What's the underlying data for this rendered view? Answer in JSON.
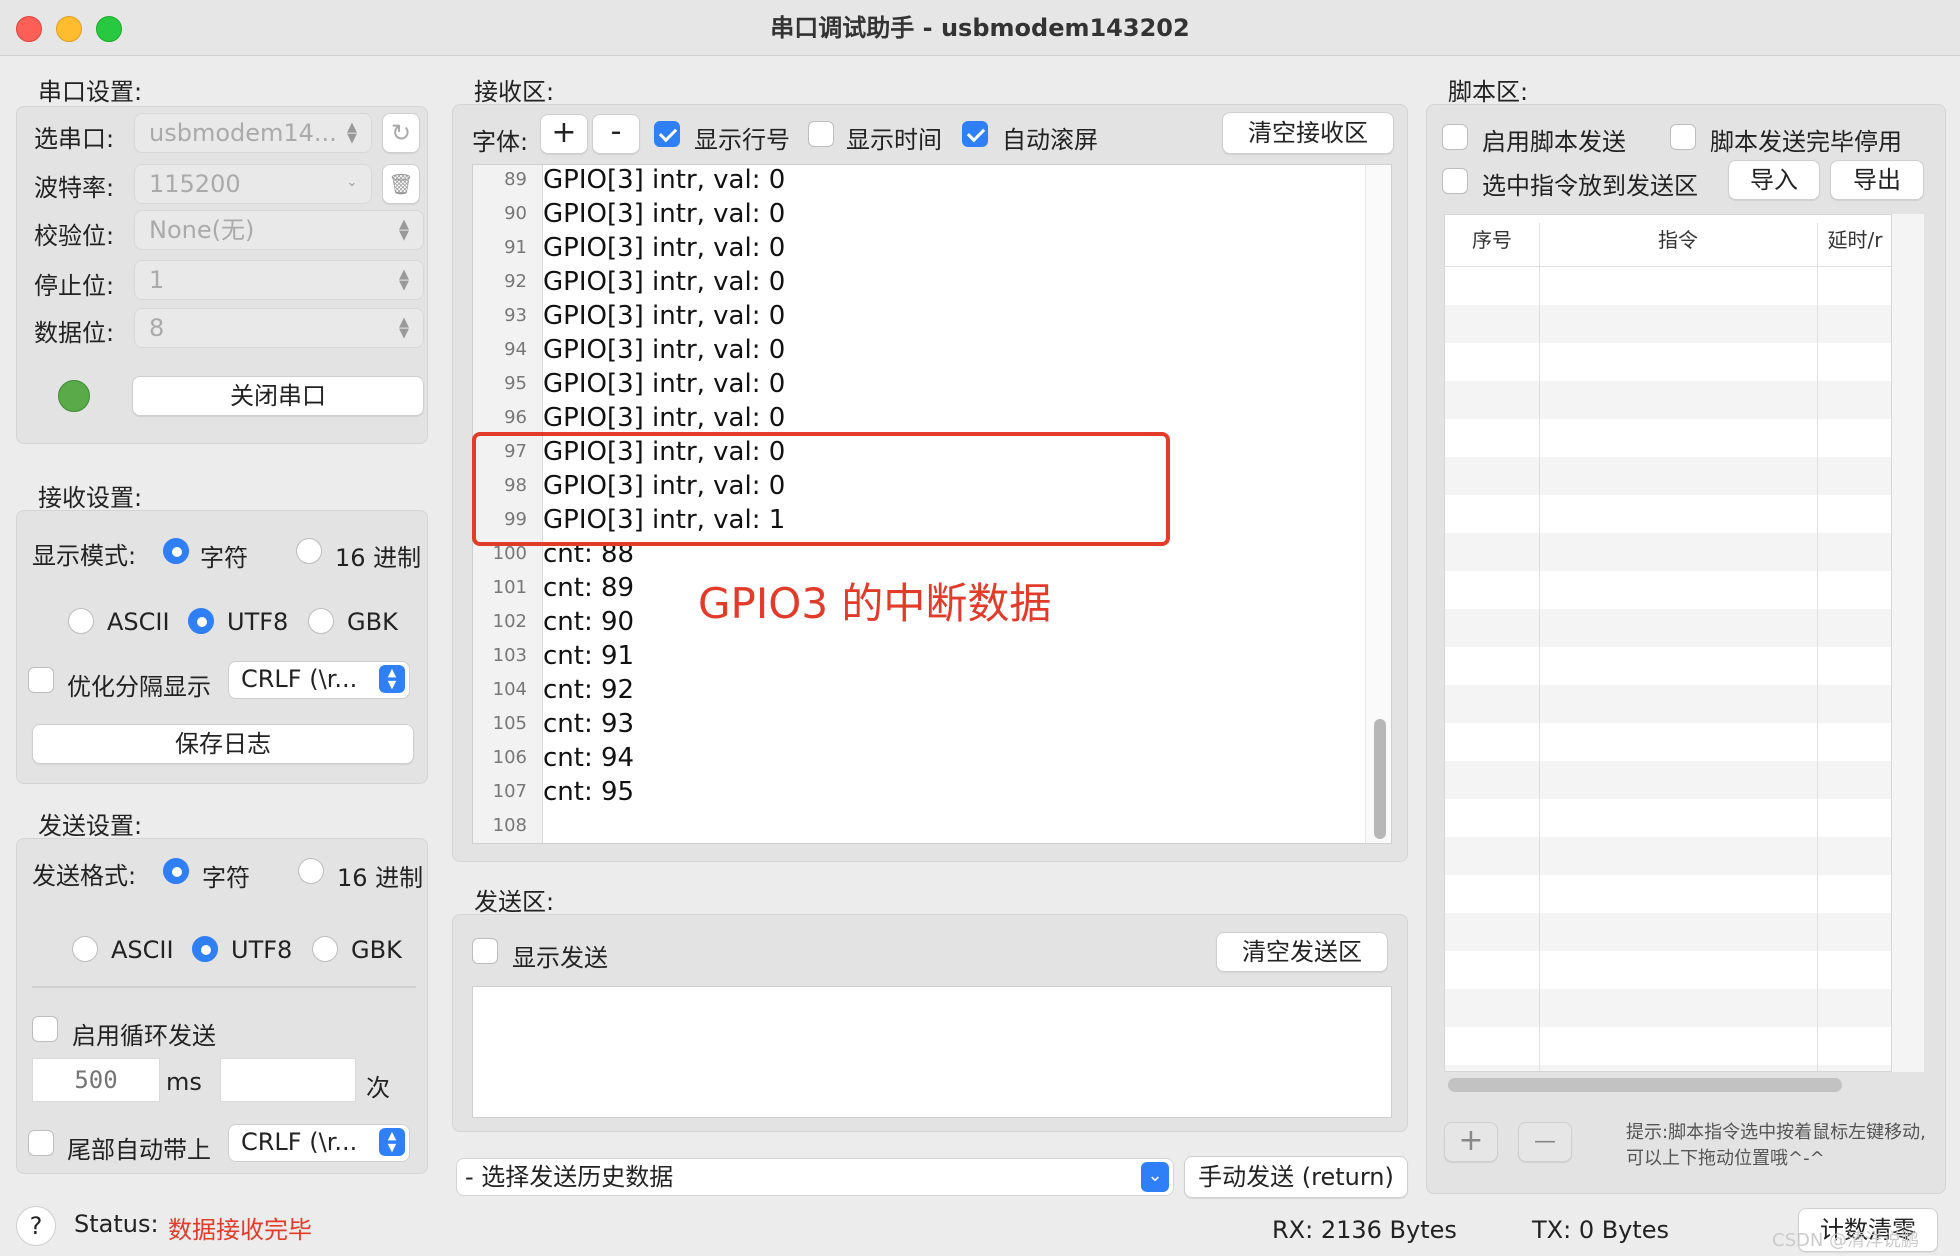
{
  "window": {
    "title": "串口调试助手 - usbmodem143202"
  },
  "serial_settings": {
    "title": "串口设置:",
    "port_label": "选串口:",
    "port_value": "usbmodem14...",
    "baud_label": "波特率:",
    "baud_value": "115200",
    "parity_label": "校验位:",
    "parity_value": "None(无)",
    "stop_label": "停止位:",
    "stop_value": "1",
    "data_label": "数据位:",
    "data_value": "8",
    "status_color": "#5aaa4a",
    "close_button": "关闭串口"
  },
  "receive_settings": {
    "title": "接收设置:",
    "display_mode_label": "显示模式:",
    "char_option": "字符",
    "hex_option": "16 进制",
    "ascii": "ASCII",
    "utf8": "UTF8",
    "gbk": "GBK",
    "optimize_label": "优化分隔显示",
    "line_end_value": "CRLF (\\r...",
    "save_log_button": "保存日志"
  },
  "send_settings": {
    "title": "发送设置:",
    "format_label": "发送格式:",
    "char_option": "字符",
    "hex_option": "16 进制",
    "ascii": "ASCII",
    "utf8": "UTF8",
    "gbk": "GBK",
    "loop_label": "启用循环发送",
    "interval_placeholder": "500",
    "ms_label": "ms",
    "times_label": "次",
    "tail_label": "尾部自动带上",
    "tail_value": "CRLF (\\r..."
  },
  "receive_area": {
    "title": "接收区:",
    "font_label": "字体:",
    "plus": "+",
    "minus": "-",
    "show_line_numbers": "显示行号",
    "show_time": "显示时间",
    "auto_scroll": "自动滚屏",
    "clear_button": "清空接收区",
    "lines": [
      {
        "n": "89",
        "text": "GPIO[3] intr, val: 0"
      },
      {
        "n": "90",
        "text": "GPIO[3] intr, val: 0"
      },
      {
        "n": "91",
        "text": "GPIO[3] intr, val: 0"
      },
      {
        "n": "92",
        "text": "GPIO[3] intr, val: 0"
      },
      {
        "n": "93",
        "text": "GPIO[3] intr, val: 0"
      },
      {
        "n": "94",
        "text": "GPIO[3] intr, val: 0"
      },
      {
        "n": "95",
        "text": "GPIO[3] intr, val: 0"
      },
      {
        "n": "96",
        "text": "GPIO[3] intr, val: 0"
      },
      {
        "n": "97",
        "text": "GPIO[3] intr, val: 0"
      },
      {
        "n": "98",
        "text": "GPIO[3] intr, val: 0"
      },
      {
        "n": "99",
        "text": "GPIO[3] intr, val: 1"
      },
      {
        "n": "100",
        "text": "cnt: 88"
      },
      {
        "n": "101",
        "text": "cnt: 89"
      },
      {
        "n": "102",
        "text": "cnt: 90"
      },
      {
        "n": "103",
        "text": "cnt: 91"
      },
      {
        "n": "104",
        "text": "cnt: 92"
      },
      {
        "n": "105",
        "text": "cnt: 93"
      },
      {
        "n": "106",
        "text": "cnt: 94"
      },
      {
        "n": "107",
        "text": "cnt: 95"
      },
      {
        "n": "108",
        "text": ""
      }
    ],
    "annotation": "GPIO3 的中断数据",
    "annotation_color": "#e23b2a"
  },
  "send_area": {
    "title": "发送区:",
    "show_send": "显示发送",
    "clear_button": "清空发送区",
    "history_placeholder": "- 选择发送历史数据",
    "send_button": "手动发送 (return)"
  },
  "script_area": {
    "title": "脚本区:",
    "enable_script": "启用脚本发送",
    "stop_after": "脚本发送完毕停用",
    "put_selected": "选中指令放到发送区",
    "import_button": "导入",
    "export_button": "导出",
    "columns": [
      "序号",
      "指令",
      "延时/r"
    ],
    "add": "+",
    "remove": "—",
    "hint": "提示:脚本指令选中按着鼠标左键移动,可以上下拖动位置哦^-^"
  },
  "status_bar": {
    "help": "?",
    "status_label": "Status:",
    "status_value": "数据接收完毕",
    "status_color": "#e23b2a",
    "rx": "RX:  2136 Bytes",
    "tx": "TX: 0 Bytes",
    "reset_button": "计数清零",
    "watermark": "CSDN @清洋说鹏"
  }
}
